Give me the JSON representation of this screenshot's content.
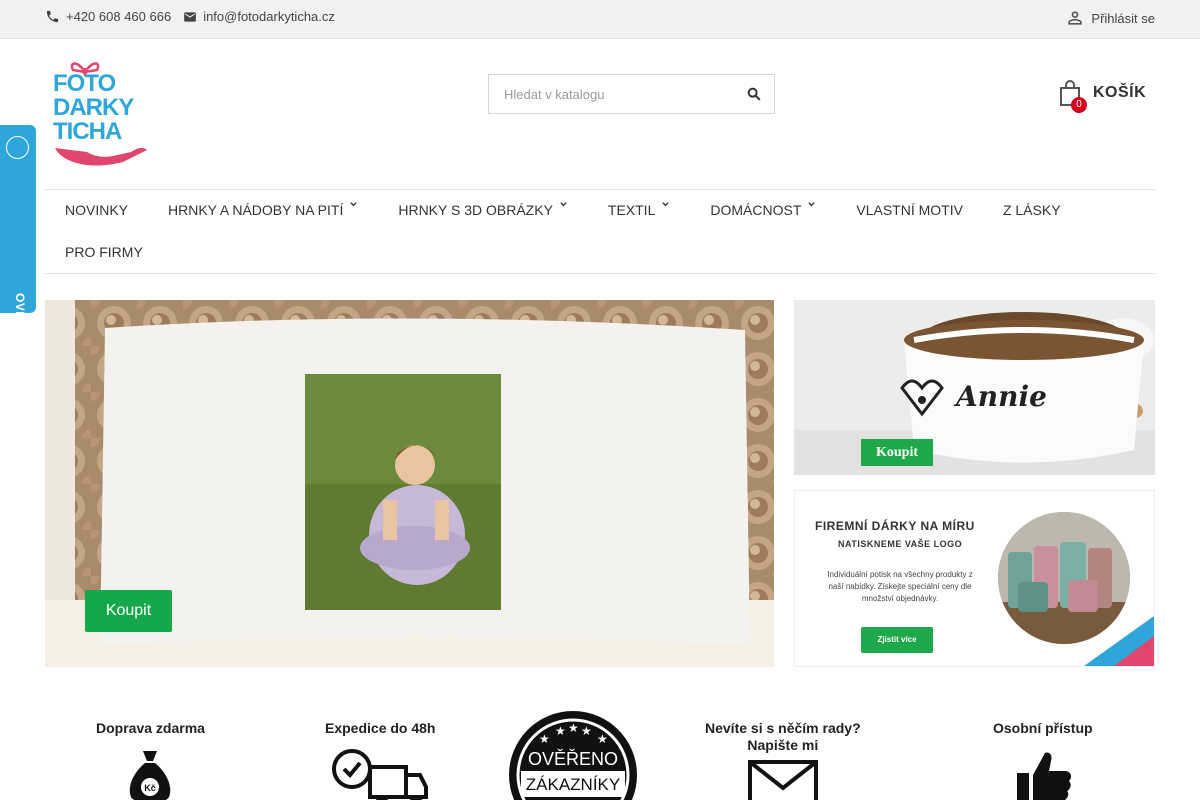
{
  "topbar": {
    "phone": "+420 608 460 666",
    "email": "info@fotodarkyticha.cz",
    "login": "Přihlásit se"
  },
  "logo": {
    "line1": "FOTO",
    "line2": "DARKY",
    "line3": "TICHA"
  },
  "search": {
    "placeholder": "Hledat v katalogu"
  },
  "cart": {
    "label": "KOŠÍK",
    "count": "0"
  },
  "nav": {
    "items": [
      {
        "label": "NOVINKY"
      },
      {
        "label": "HRNKY A NÁDOBY NA PITÍ"
      },
      {
        "label": "HRNKY S 3D OBRÁZKY"
      },
      {
        "label": "TEXTIL"
      },
      {
        "label": "DOMÁCNOST"
      },
      {
        "label": "VLASTNÍ MOTIV"
      },
      {
        "label": "Z LÁSKY"
      },
      {
        "label": "PRO FIRMY"
      }
    ]
  },
  "side_badge": {
    "label": "OVĚŘENO ZÁKAZNÍKY"
  },
  "hero": {
    "buy_label": "Koupit"
  },
  "banner_bowl": {
    "name": "Annie",
    "buy_label": "Koupit"
  },
  "banner_corporate": {
    "title": "FIREMNÍ DÁRKY NA MÍRU",
    "subtitle": "NATISKNEME VAŠE LOGO",
    "text": "Individuální potisk na všechny produkty z naší nabídky. Získejte speciální ceny dle množství objednávky.",
    "button": "Zjistit více"
  },
  "benefits": {
    "shipping": "Doprava zdarma",
    "dispatch": "Expedice do 48h",
    "seal_line1": "OVĚŘENO",
    "seal_line2": "ZÁKAZNÍKY",
    "advice_line1": "Nevíte si s něčím rady?",
    "advice_line2": "Napište mi",
    "personal": "Osobní přístup",
    "currency": "Kč"
  },
  "colors": {
    "brand_blue": "#2fa6d9",
    "brand_pink": "#e0466e",
    "buy_green": "#15a84a",
    "badge_red": "#d0021b"
  }
}
